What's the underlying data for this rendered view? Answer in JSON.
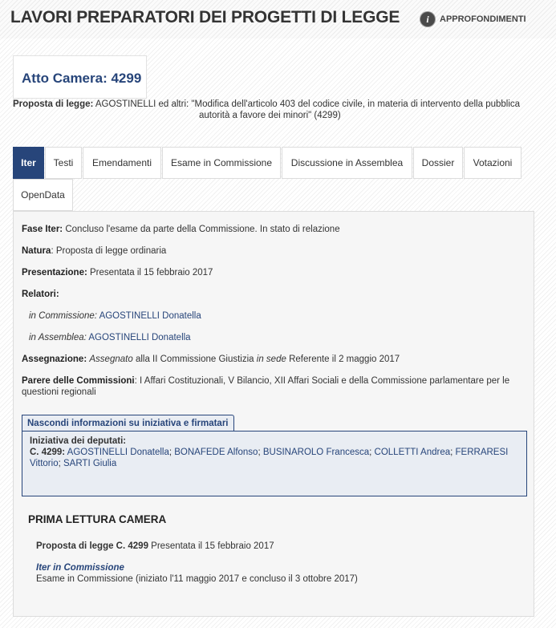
{
  "header": {
    "title": "LAVORI PREPARATORI DEI PROGETTI DI LEGGE",
    "approfondimenti_label": "APPROFONDIMENTI",
    "info_icon_glyph": "i",
    "info_icon_name": "info-icon"
  },
  "atto": {
    "title": "Atto Camera: 4299",
    "proposta_label": "Proposta di legge:",
    "proposta_line1": "AGOSTINELLI ed altri: \"Modifica dell'articolo 403 del codice civile, in materia di intervento della pubblica",
    "proposta_line2": "autorità a favore dei minori\" (4299)"
  },
  "tabs": [
    {
      "label": "Iter",
      "active": true
    },
    {
      "label": "Testi",
      "active": false
    },
    {
      "label": "Emendamenti",
      "active": false
    },
    {
      "label": "Esame in Commissione",
      "active": false
    },
    {
      "label": "Discussione in Assemblea",
      "active": false
    },
    {
      "label": "Dossier",
      "active": false
    },
    {
      "label": "Votazioni",
      "active": false
    },
    {
      "label": "OpenData",
      "active": false
    }
  ],
  "iter": {
    "fase_label": "Fase Iter:",
    "fase_value": "Concluso l'esame da parte della Commissione. In stato di relazione",
    "natura_label": "Natura",
    "natura_value": ": Proposta di legge ordinaria",
    "presentazione_label": "Presentazione:",
    "presentazione_value": "Presentata il 15 febbraio 2017",
    "relatori_label": "Relatori:",
    "relatore_commissione_label": "in Commissione:",
    "relatore_commissione_name": "AGOSTINELLI Donatella",
    "relatore_assemblea_label": "in Assemblea:",
    "relatore_assemblea_name": "AGOSTINELLI Donatella",
    "assegnazione_label": "Assegnazione:",
    "assegnazione_italic1": "Assegnato",
    "assegnazione_mid": "alla II Commissione Giustizia",
    "assegnazione_italic2": "in sede",
    "assegnazione_end": "Referente il 2 maggio 2017",
    "parere_label": "Parere delle Commissioni",
    "parere_line1": ": I Affari Costituzionali, V Bilancio, XII Affari Sociali e della Commissione parlamentare per le",
    "parere_line2": "questioni regionali"
  },
  "iniziativa": {
    "toggle_label": "Nascondi informazioni su iniziativa e firmatari",
    "heading": "Iniziativa dei deputati:",
    "atto_ref": "C. 4299:",
    "deputati": [
      "AGOSTINELLI Donatella",
      "BONAFEDE Alfonso",
      "BUSINAROLO Francesca",
      "COLLETTI Andrea",
      "FERRARESI Vittorio",
      "SARTI Giulia"
    ]
  },
  "lettura": {
    "section_title": "PRIMA LETTURA CAMERA",
    "proposta_bold": "Proposta di legge C. 4299",
    "proposta_rest": "Presentata il 15 febbraio 2017",
    "iter_link": "Iter in Commissione",
    "esame_text": "Esame in Commissione (iniziato l'11 maggio 2017 e concluso il 3 ottobre 2017)"
  },
  "colors": {
    "accent": "#27457a",
    "tab_active_bg": "#27457a",
    "panel_bg": "#f6f6f6",
    "iniziativa_bg": "#e9edf3"
  }
}
